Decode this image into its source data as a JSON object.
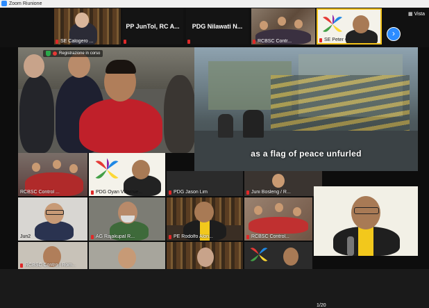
{
  "window": {
    "title": "Zoom Riunione"
  },
  "top_strip": {
    "thumbnails": [
      {
        "name": "SE Calogero ..."
      },
      {
        "name": "PP JunTol, RC A..."
      },
      {
        "name": "PDG Nilawati N..."
      },
      {
        "name": "RCBSC Contr..."
      },
      {
        "name": "SE Peter Cat..."
      }
    ],
    "view_label": "Vista",
    "next_icon": "chevron-right-icon"
  },
  "main_video": {
    "recording_label": "Registrazione in corso",
    "caption": "as a flag of peace unfurled"
  },
  "gallery_tiles": [
    {
      "name": "RCBSC Control ..."
    },
    {
      "name": "PDG Oyan Villarrue..."
    },
    {
      "name": "PDG Jason Lim"
    },
    {
      "name": "Juni Bosleng / R..."
    },
    {
      "name": "Jun2"
    },
    {
      "name": "AG Rajakupal R..."
    },
    {
      "name": "PE Rodolfo Alon..."
    },
    {
      "name": "RCBSC Control..."
    },
    {
      "name": "RCBSC Contro | Rom..."
    }
  ],
  "page_counter": "1/20"
}
